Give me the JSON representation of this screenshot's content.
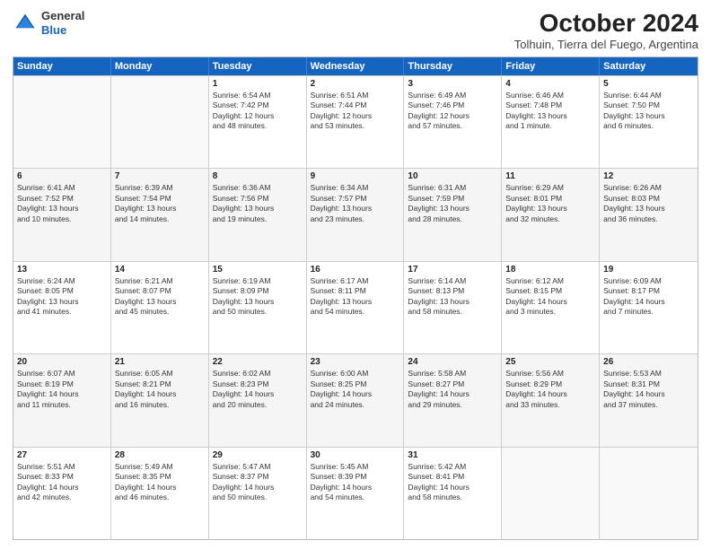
{
  "header": {
    "logo_general": "General",
    "logo_blue": "Blue",
    "month": "October 2024",
    "location": "Tolhuin, Tierra del Fuego, Argentina"
  },
  "days_of_week": [
    "Sunday",
    "Monday",
    "Tuesday",
    "Wednesday",
    "Thursday",
    "Friday",
    "Saturday"
  ],
  "weeks": [
    [
      {
        "day": "",
        "info": ""
      },
      {
        "day": "",
        "info": ""
      },
      {
        "day": "1",
        "info": "Sunrise: 6:54 AM\nSunset: 7:42 PM\nDaylight: 12 hours\nand 48 minutes."
      },
      {
        "day": "2",
        "info": "Sunrise: 6:51 AM\nSunset: 7:44 PM\nDaylight: 12 hours\nand 53 minutes."
      },
      {
        "day": "3",
        "info": "Sunrise: 6:49 AM\nSunset: 7:46 PM\nDaylight: 12 hours\nand 57 minutes."
      },
      {
        "day": "4",
        "info": "Sunrise: 6:46 AM\nSunset: 7:48 PM\nDaylight: 13 hours\nand 1 minute."
      },
      {
        "day": "5",
        "info": "Sunrise: 6:44 AM\nSunset: 7:50 PM\nDaylight: 13 hours\nand 6 minutes."
      }
    ],
    [
      {
        "day": "6",
        "info": "Sunrise: 6:41 AM\nSunset: 7:52 PM\nDaylight: 13 hours\nand 10 minutes."
      },
      {
        "day": "7",
        "info": "Sunrise: 6:39 AM\nSunset: 7:54 PM\nDaylight: 13 hours\nand 14 minutes."
      },
      {
        "day": "8",
        "info": "Sunrise: 6:36 AM\nSunset: 7:56 PM\nDaylight: 13 hours\nand 19 minutes."
      },
      {
        "day": "9",
        "info": "Sunrise: 6:34 AM\nSunset: 7:57 PM\nDaylight: 13 hours\nand 23 minutes."
      },
      {
        "day": "10",
        "info": "Sunrise: 6:31 AM\nSunset: 7:59 PM\nDaylight: 13 hours\nand 28 minutes."
      },
      {
        "day": "11",
        "info": "Sunrise: 6:29 AM\nSunset: 8:01 PM\nDaylight: 13 hours\nand 32 minutes."
      },
      {
        "day": "12",
        "info": "Sunrise: 6:26 AM\nSunset: 8:03 PM\nDaylight: 13 hours\nand 36 minutes."
      }
    ],
    [
      {
        "day": "13",
        "info": "Sunrise: 6:24 AM\nSunset: 8:05 PM\nDaylight: 13 hours\nand 41 minutes."
      },
      {
        "day": "14",
        "info": "Sunrise: 6:21 AM\nSunset: 8:07 PM\nDaylight: 13 hours\nand 45 minutes."
      },
      {
        "day": "15",
        "info": "Sunrise: 6:19 AM\nSunset: 8:09 PM\nDaylight: 13 hours\nand 50 minutes."
      },
      {
        "day": "16",
        "info": "Sunrise: 6:17 AM\nSunset: 8:11 PM\nDaylight: 13 hours\nand 54 minutes."
      },
      {
        "day": "17",
        "info": "Sunrise: 6:14 AM\nSunset: 8:13 PM\nDaylight: 13 hours\nand 58 minutes."
      },
      {
        "day": "18",
        "info": "Sunrise: 6:12 AM\nSunset: 8:15 PM\nDaylight: 14 hours\nand 3 minutes."
      },
      {
        "day": "19",
        "info": "Sunrise: 6:09 AM\nSunset: 8:17 PM\nDaylight: 14 hours\nand 7 minutes."
      }
    ],
    [
      {
        "day": "20",
        "info": "Sunrise: 6:07 AM\nSunset: 8:19 PM\nDaylight: 14 hours\nand 11 minutes."
      },
      {
        "day": "21",
        "info": "Sunrise: 6:05 AM\nSunset: 8:21 PM\nDaylight: 14 hours\nand 16 minutes."
      },
      {
        "day": "22",
        "info": "Sunrise: 6:02 AM\nSunset: 8:23 PM\nDaylight: 14 hours\nand 20 minutes."
      },
      {
        "day": "23",
        "info": "Sunrise: 6:00 AM\nSunset: 8:25 PM\nDaylight: 14 hours\nand 24 minutes."
      },
      {
        "day": "24",
        "info": "Sunrise: 5:58 AM\nSunset: 8:27 PM\nDaylight: 14 hours\nand 29 minutes."
      },
      {
        "day": "25",
        "info": "Sunrise: 5:56 AM\nSunset: 8:29 PM\nDaylight: 14 hours\nand 33 minutes."
      },
      {
        "day": "26",
        "info": "Sunrise: 5:53 AM\nSunset: 8:31 PM\nDaylight: 14 hours\nand 37 minutes."
      }
    ],
    [
      {
        "day": "27",
        "info": "Sunrise: 5:51 AM\nSunset: 8:33 PM\nDaylight: 14 hours\nand 42 minutes."
      },
      {
        "day": "28",
        "info": "Sunrise: 5:49 AM\nSunset: 8:35 PM\nDaylight: 14 hours\nand 46 minutes."
      },
      {
        "day": "29",
        "info": "Sunrise: 5:47 AM\nSunset: 8:37 PM\nDaylight: 14 hours\nand 50 minutes."
      },
      {
        "day": "30",
        "info": "Sunrise: 5:45 AM\nSunset: 8:39 PM\nDaylight: 14 hours\nand 54 minutes."
      },
      {
        "day": "31",
        "info": "Sunrise: 5:42 AM\nSunset: 8:41 PM\nDaylight: 14 hours\nand 58 minutes."
      },
      {
        "day": "",
        "info": ""
      },
      {
        "day": "",
        "info": ""
      }
    ]
  ]
}
